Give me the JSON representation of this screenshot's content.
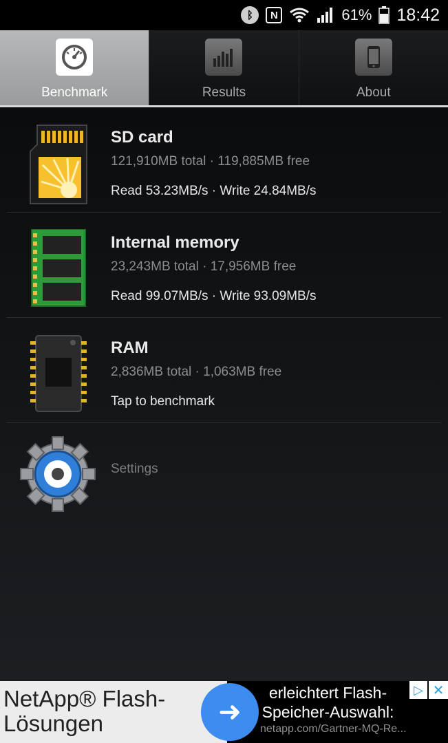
{
  "status_bar": {
    "battery_percent": "61%",
    "time": "18:42",
    "bluetooth_icon": "bluetooth-icon",
    "nfc_icon": "nfc-icon",
    "wifi_icon": "wifi-icon",
    "signal_icon": "signal-icon",
    "battery_icon": "battery-icon"
  },
  "tabs": [
    {
      "label": "Benchmark",
      "icon": "speedometer-icon",
      "active": true
    },
    {
      "label": "Results",
      "icon": "bar-chart-icon",
      "active": false
    },
    {
      "label": "About",
      "icon": "phone-icon",
      "active": false
    }
  ],
  "items": [
    {
      "title": "SD card",
      "subtitle": "121,910MB total · 119,885MB free",
      "detail": "Read 53.23MB/s · Write 24.84MB/s",
      "icon": "sd-card-icon"
    },
    {
      "title": "Internal memory",
      "subtitle": "23,243MB total · 17,956MB free",
      "detail": "Read 99.07MB/s · Write 93.09MB/s",
      "icon": "memory-module-icon"
    },
    {
      "title": "RAM",
      "subtitle": "2,836MB total · 1,063MB free",
      "detail": "Tap to benchmark",
      "icon": "ram-chip-icon"
    }
  ],
  "settings": {
    "label": "Settings",
    "icon": "gear-icon"
  },
  "ad": {
    "left_line1": "NetApp® Flash-",
    "left_line2": "Lösungen",
    "right_line1": "erleichtert Flash-",
    "right_line2": "Speicher-Auswahl:",
    "url": "netapp.com/Gartner-MQ-Re...",
    "button_icon": "arrow-right-icon",
    "accent": "#3d8cf0"
  }
}
